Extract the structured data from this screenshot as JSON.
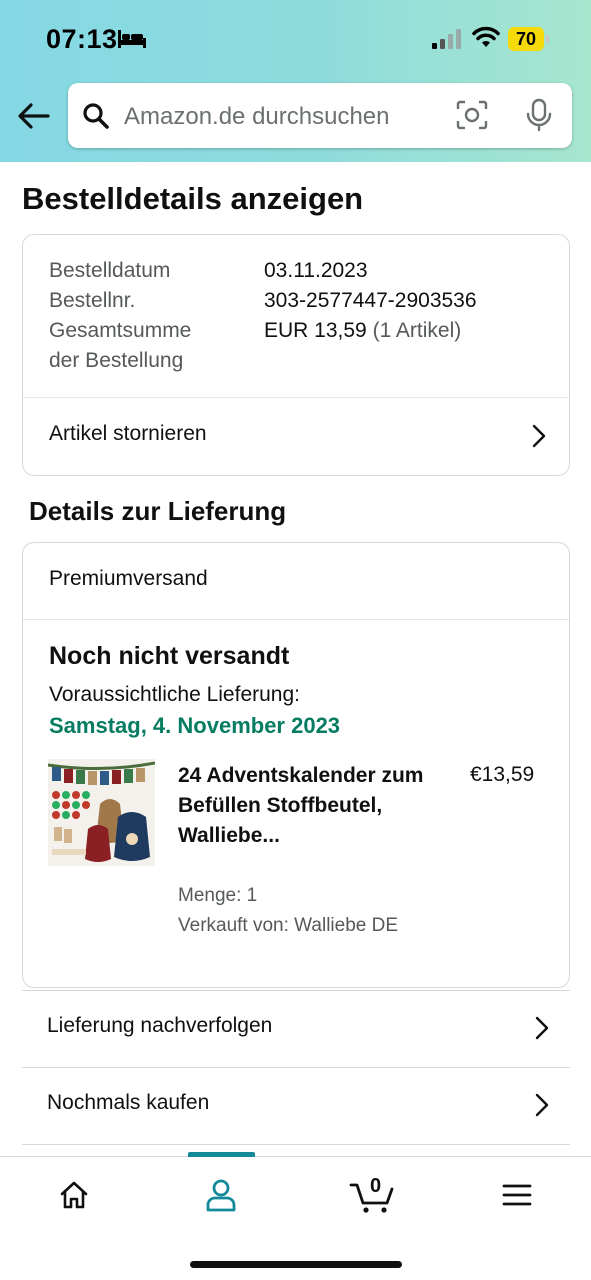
{
  "status_bar": {
    "time": "07:13",
    "battery": "70"
  },
  "search": {
    "placeholder": "Amazon.de durchsuchen"
  },
  "page": {
    "title": "Bestelldetails anzeigen"
  },
  "order": {
    "date_label": "Bestelldatum",
    "date_value": "03.11.2023",
    "number_label": "Bestellnr.",
    "number_value": "303-2577447-2903536",
    "total_label_line1": "Gesamtsumme",
    "total_label_line2": "der Bestellung",
    "total_value": "EUR 13,59",
    "total_items": "(1 Artikel)",
    "cancel_label": "Artikel stornieren"
  },
  "delivery": {
    "section_title": "Details zur Lieferung",
    "shipping_type": "Premiumversand",
    "status": "Noch nicht versandt",
    "expected_label": "Voraussichtliche Lieferung:",
    "expected_date": "Samstag, 4. November 2023",
    "product": {
      "title": "24 Adventskalender zum Befüllen Stoffbeutel, Walliebe...",
      "price": "€13,59",
      "quantity": "Menge: 1",
      "seller": "Verkauft von: Walliebe DE",
      "image_icon": "advent-calendar-bags-image"
    }
  },
  "actions": [
    {
      "label": "Lieferung nachverfolgen"
    },
    {
      "label": "Nochmals kaufen"
    }
  ],
  "bottom_nav": {
    "items": [
      "home-icon",
      "account-icon",
      "cart-icon",
      "menu-icon"
    ],
    "active": "account-icon",
    "cart_count": "0"
  },
  "colors": {
    "accent": "#138a9a",
    "delivery_date": "#067d62",
    "header_gradient_start": "#84d8e4",
    "header_gradient_end": "#a7e6cf"
  }
}
